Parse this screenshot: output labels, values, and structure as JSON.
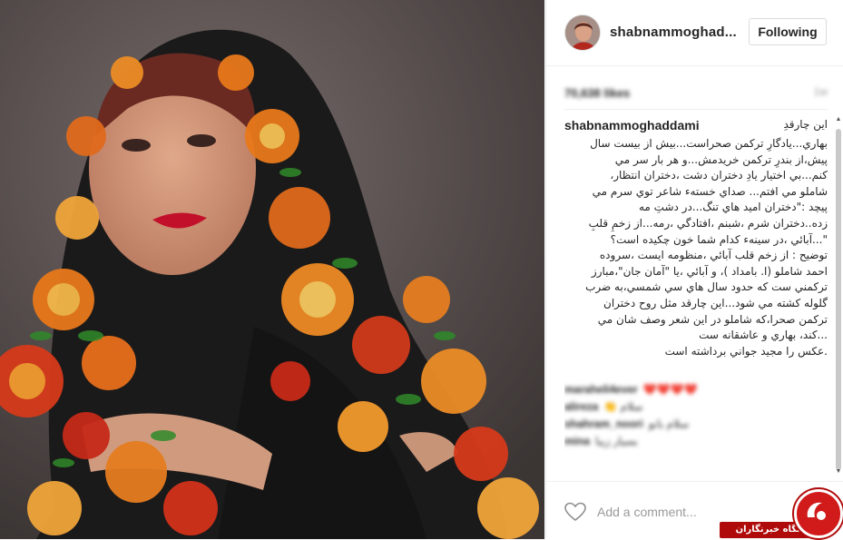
{
  "post": {
    "username": "shabnammoghad...",
    "follow_label": "Following",
    "likes": "70,638 likes",
    "time": "1w"
  },
  "caption": {
    "username": "shabnammoghaddami",
    "first_line": "اين چارقدِ",
    "lines": [
      "بهاري...يادگارِ تركمن صحراست...بيش از بيست سال",
      "پيش،از بندرِ تركمن خريدمش...و هر بار سر مي",
      "كنم...بي اختيار يادِ دختران دشت ،دختران انتظار،",
      "شاملو مي افتم... صداي خسته‌ء شاعر توي سرم مي",
      "پيچد :\"دختران اميد هاي تنگ...در دشتِ مه",
      "زده..دختران شرم ،شبنم ،افتادگي ،رمه...از زخمِ قلبِ",
      "\"...آبائي ،در سينه‌ء كدام شما خون چكيده است؟",
      "توضيح : از زخم قلب آبائي ،منظومه ايست ،سروده",
      "احمد شاملو (ا. بامداد )، و آبائي ،يا \"آمان جان\"،مبارز",
      "تركمني ست كه حدود سال هاي سي شمسي،به ضرب",
      "گلوله كشته مي شود...اين چارقد مثل روح دختران",
      "تركمن صحرا،كه شاملو در اين شعر وصف شان مي",
      "...كند، بهاري و عاشقانه ست",
      ".عكس را مجيد جواني برداشته است"
    ]
  },
  "comments": [
    {
      "user": "maraheli4ever",
      "text": "❤️❤️❤️❤️"
    },
    {
      "user": "alireza",
      "text": "👏 سلام"
    },
    {
      "user": "shahram_noori",
      "text": "سلام بانو"
    },
    {
      "user": "mina",
      "text": "بسيار زيبا"
    }
  ],
  "comment_box": {
    "placeholder": "Add a comment..."
  },
  "watermark": {
    "label": "باشگاه خبرنگاران"
  },
  "colors": {
    "watermark_red": "#b00b0b",
    "border": "#efefef"
  }
}
